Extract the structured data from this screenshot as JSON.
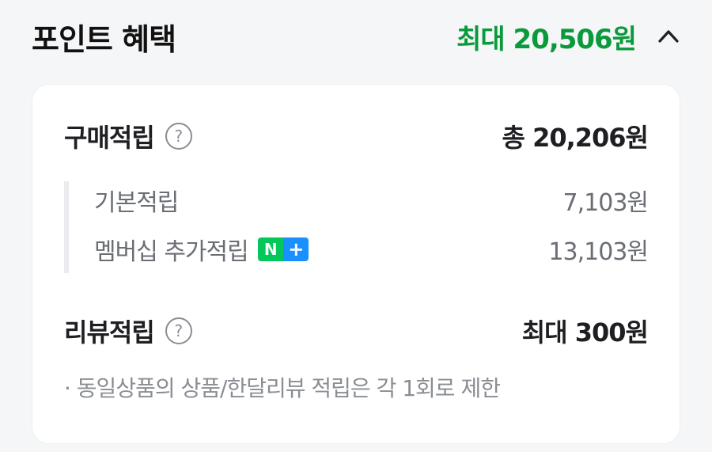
{
  "header": {
    "title": "포인트 혜택",
    "max_label": "최대 20,506원",
    "collapse_icon": "chevron-up-icon"
  },
  "purchase": {
    "title": "구매적립",
    "help_icon_glyph": "?",
    "total": "총 20,206원",
    "items": [
      {
        "label": "기본적립",
        "value": "7,103원"
      },
      {
        "label": "멤버십 추가적립",
        "value": "13,103원",
        "badge": {
          "n": "N",
          "plus": "+"
        }
      }
    ]
  },
  "review": {
    "title": "리뷰적립",
    "help_icon_glyph": "?",
    "value": "최대 300원"
  },
  "note": "· 동일상품의 상품/한달리뷰 적립은 각 1회로 제한",
  "colors": {
    "accent_green": "#0a9a3c",
    "badge_green": "#03c75a",
    "badge_blue": "#1a90ff"
  }
}
